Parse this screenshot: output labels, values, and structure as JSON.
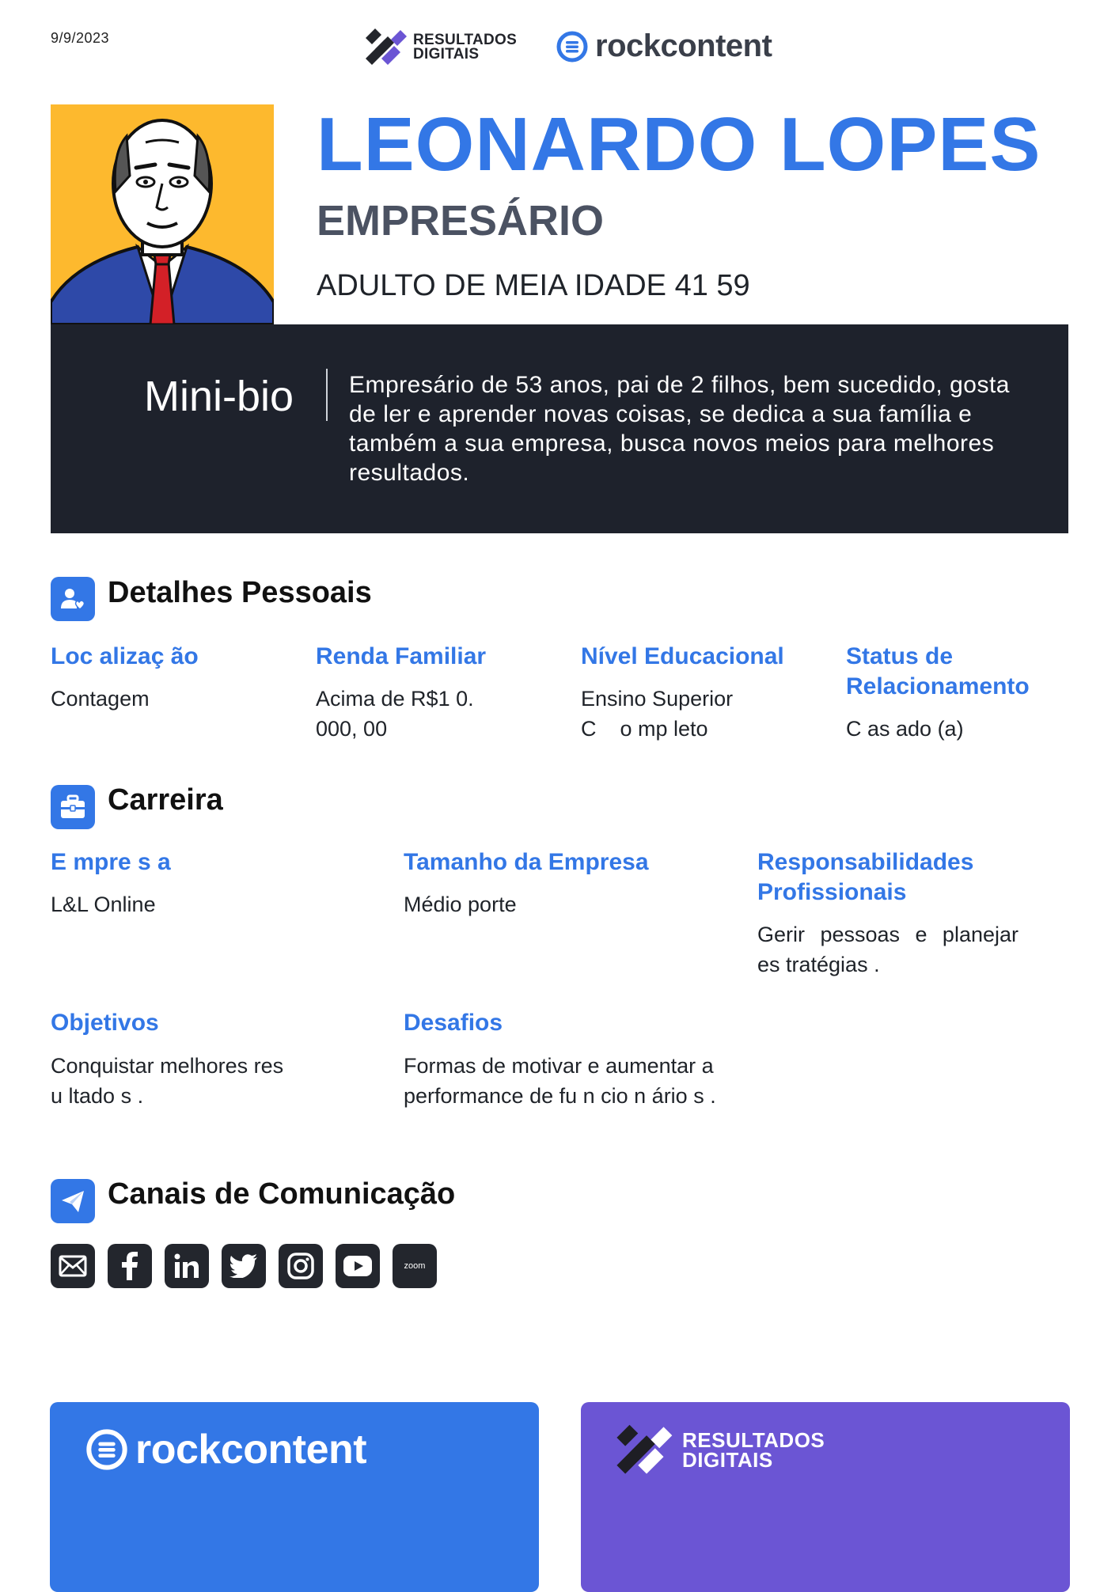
{
  "date": "9/9/2023",
  "brands": {
    "rd_line1": "RESULTADOS",
    "rd_line2": "DIGITAIS",
    "rc": "rockcontent"
  },
  "persona": {
    "name": "LEONARDO LOPES",
    "role": "EMPRESÁRIO",
    "age": "ADULTO DE MEIA IDADE  41 59"
  },
  "bio": {
    "title": "Mini-bio",
    "text": "Empresário de 53 anos, pai de 2 filhos, bem sucedido, gosta de ler e aprender novas coisas, se dedica a sua família e também a sua empresa, busca novos meios para melhores resultados."
  },
  "personal": {
    "title": "Detalhes Pessoais",
    "items": [
      {
        "label": "Loc alizaç ão",
        "value": "Contagem"
      },
      {
        "label": "Renda Familiar",
        "value": "Acima de R$1 0. 000, 00"
      },
      {
        "label": "Nível Educacional",
        "value": "Ensino Superior    C    o mp leto"
      },
      {
        "label": "Status de Relacionamento",
        "value": "C as ado (a)"
      }
    ]
  },
  "career": {
    "title": "Carreira",
    "items": [
      {
        "label": "E mpre s a",
        "value": "L&L Online"
      },
      {
        "label": "Tamanho da Empresa",
        "value": "Médio porte"
      },
      {
        "label": "Responsabilidades Profissionais",
        "value": "Gerir pessoas e planejar es tratégias ."
      },
      {
        "label": "Objetivos",
        "value": "Conquistar melhores res u ltado s ."
      },
      {
        "label": "Desafios",
        "value": "Formas de motivar e aumentar a performance de fu n cio n ário s ."
      }
    ]
  },
  "channels": {
    "title": "Canais de Comunicação",
    "icons": [
      "email-icon",
      "facebook-icon",
      "linkedin-icon",
      "twitter-icon",
      "instagram-icon",
      "youtube-icon",
      "zoom-icon"
    ],
    "zoom_label": "zoom"
  },
  "colors": {
    "accent": "#3377e6",
    "dark": "#1e222c",
    "avatar_bg": "#fdb92e",
    "purple": "#6b55d4"
  }
}
